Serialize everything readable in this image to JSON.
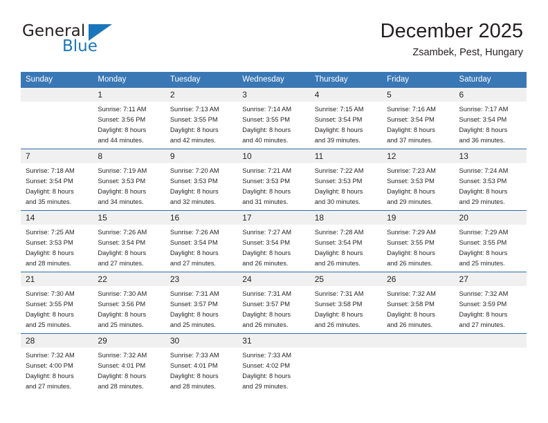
{
  "brand": {
    "name_top": "General",
    "name_bottom": "Blue",
    "color_primary": "#1a76bc",
    "color_text": "#231f20",
    "triangle_icon": "triangle-icon"
  },
  "header": {
    "title": "December 2025",
    "location": "Zsambek, Pest, Hungary"
  },
  "theme": {
    "header_row_bg": "#3a78b5",
    "header_row_text": "#ffffff",
    "daynum_bg": "#f0f0f0",
    "cell_border": "#2f6aa8"
  },
  "weekdays": [
    "Sunday",
    "Monday",
    "Tuesday",
    "Wednesday",
    "Thursday",
    "Friday",
    "Saturday"
  ],
  "weeks": [
    [
      {
        "day": "",
        "lines": []
      },
      {
        "day": "1",
        "lines": [
          "Sunrise: 7:11 AM",
          "Sunset: 3:56 PM",
          "Daylight: 8 hours",
          "and 44 minutes."
        ]
      },
      {
        "day": "2",
        "lines": [
          "Sunrise: 7:13 AM",
          "Sunset: 3:55 PM",
          "Daylight: 8 hours",
          "and 42 minutes."
        ]
      },
      {
        "day": "3",
        "lines": [
          "Sunrise: 7:14 AM",
          "Sunset: 3:55 PM",
          "Daylight: 8 hours",
          "and 40 minutes."
        ]
      },
      {
        "day": "4",
        "lines": [
          "Sunrise: 7:15 AM",
          "Sunset: 3:54 PM",
          "Daylight: 8 hours",
          "and 39 minutes."
        ]
      },
      {
        "day": "5",
        "lines": [
          "Sunrise: 7:16 AM",
          "Sunset: 3:54 PM",
          "Daylight: 8 hours",
          "and 37 minutes."
        ]
      },
      {
        "day": "6",
        "lines": [
          "Sunrise: 7:17 AM",
          "Sunset: 3:54 PM",
          "Daylight: 8 hours",
          "and 36 minutes."
        ]
      }
    ],
    [
      {
        "day": "7",
        "lines": [
          "Sunrise: 7:18 AM",
          "Sunset: 3:54 PM",
          "Daylight: 8 hours",
          "and 35 minutes."
        ]
      },
      {
        "day": "8",
        "lines": [
          "Sunrise: 7:19 AM",
          "Sunset: 3:53 PM",
          "Daylight: 8 hours",
          "and 34 minutes."
        ]
      },
      {
        "day": "9",
        "lines": [
          "Sunrise: 7:20 AM",
          "Sunset: 3:53 PM",
          "Daylight: 8 hours",
          "and 32 minutes."
        ]
      },
      {
        "day": "10",
        "lines": [
          "Sunrise: 7:21 AM",
          "Sunset: 3:53 PM",
          "Daylight: 8 hours",
          "and 31 minutes."
        ]
      },
      {
        "day": "11",
        "lines": [
          "Sunrise: 7:22 AM",
          "Sunset: 3:53 PM",
          "Daylight: 8 hours",
          "and 30 minutes."
        ]
      },
      {
        "day": "12",
        "lines": [
          "Sunrise: 7:23 AM",
          "Sunset: 3:53 PM",
          "Daylight: 8 hours",
          "and 29 minutes."
        ]
      },
      {
        "day": "13",
        "lines": [
          "Sunrise: 7:24 AM",
          "Sunset: 3:53 PM",
          "Daylight: 8 hours",
          "and 29 minutes."
        ]
      }
    ],
    [
      {
        "day": "14",
        "lines": [
          "Sunrise: 7:25 AM",
          "Sunset: 3:53 PM",
          "Daylight: 8 hours",
          "and 28 minutes."
        ]
      },
      {
        "day": "15",
        "lines": [
          "Sunrise: 7:26 AM",
          "Sunset: 3:54 PM",
          "Daylight: 8 hours",
          "and 27 minutes."
        ]
      },
      {
        "day": "16",
        "lines": [
          "Sunrise: 7:26 AM",
          "Sunset: 3:54 PM",
          "Daylight: 8 hours",
          "and 27 minutes."
        ]
      },
      {
        "day": "17",
        "lines": [
          "Sunrise: 7:27 AM",
          "Sunset: 3:54 PM",
          "Daylight: 8 hours",
          "and 26 minutes."
        ]
      },
      {
        "day": "18",
        "lines": [
          "Sunrise: 7:28 AM",
          "Sunset: 3:54 PM",
          "Daylight: 8 hours",
          "and 26 minutes."
        ]
      },
      {
        "day": "19",
        "lines": [
          "Sunrise: 7:29 AM",
          "Sunset: 3:55 PM",
          "Daylight: 8 hours",
          "and 26 minutes."
        ]
      },
      {
        "day": "20",
        "lines": [
          "Sunrise: 7:29 AM",
          "Sunset: 3:55 PM",
          "Daylight: 8 hours",
          "and 25 minutes."
        ]
      }
    ],
    [
      {
        "day": "21",
        "lines": [
          "Sunrise: 7:30 AM",
          "Sunset: 3:55 PM",
          "Daylight: 8 hours",
          "and 25 minutes."
        ]
      },
      {
        "day": "22",
        "lines": [
          "Sunrise: 7:30 AM",
          "Sunset: 3:56 PM",
          "Daylight: 8 hours",
          "and 25 minutes."
        ]
      },
      {
        "day": "23",
        "lines": [
          "Sunrise: 7:31 AM",
          "Sunset: 3:57 PM",
          "Daylight: 8 hours",
          "and 25 minutes."
        ]
      },
      {
        "day": "24",
        "lines": [
          "Sunrise: 7:31 AM",
          "Sunset: 3:57 PM",
          "Daylight: 8 hours",
          "and 26 minutes."
        ]
      },
      {
        "day": "25",
        "lines": [
          "Sunrise: 7:31 AM",
          "Sunset: 3:58 PM",
          "Daylight: 8 hours",
          "and 26 minutes."
        ]
      },
      {
        "day": "26",
        "lines": [
          "Sunrise: 7:32 AM",
          "Sunset: 3:58 PM",
          "Daylight: 8 hours",
          "and 26 minutes."
        ]
      },
      {
        "day": "27",
        "lines": [
          "Sunrise: 7:32 AM",
          "Sunset: 3:59 PM",
          "Daylight: 8 hours",
          "and 27 minutes."
        ]
      }
    ],
    [
      {
        "day": "28",
        "lines": [
          "Sunrise: 7:32 AM",
          "Sunset: 4:00 PM",
          "Daylight: 8 hours",
          "and 27 minutes."
        ]
      },
      {
        "day": "29",
        "lines": [
          "Sunrise: 7:32 AM",
          "Sunset: 4:01 PM",
          "Daylight: 8 hours",
          "and 28 minutes."
        ]
      },
      {
        "day": "30",
        "lines": [
          "Sunrise: 7:33 AM",
          "Sunset: 4:01 PM",
          "Daylight: 8 hours",
          "and 28 minutes."
        ]
      },
      {
        "day": "31",
        "lines": [
          "Sunrise: 7:33 AM",
          "Sunset: 4:02 PM",
          "Daylight: 8 hours",
          "and 29 minutes."
        ]
      },
      {
        "day": "",
        "lines": []
      },
      {
        "day": "",
        "lines": []
      },
      {
        "day": "",
        "lines": []
      }
    ]
  ]
}
